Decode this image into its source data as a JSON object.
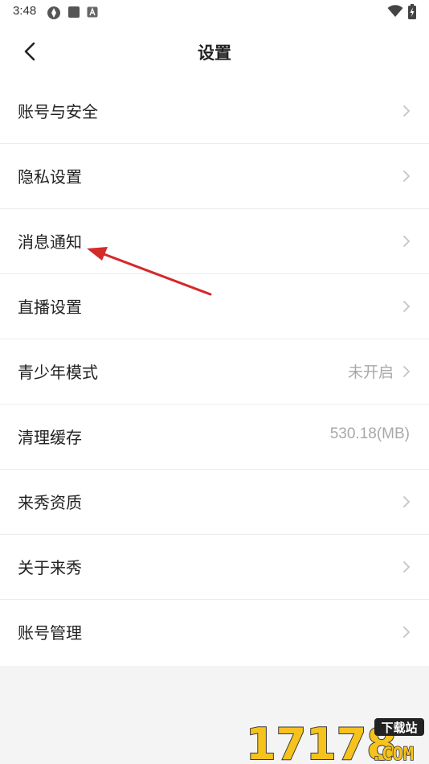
{
  "status": {
    "time": "3:48"
  },
  "header": {
    "title": "设置"
  },
  "rows": [
    {
      "label": "账号与安全",
      "value": "",
      "chevron": true
    },
    {
      "label": "隐私设置",
      "value": "",
      "chevron": true
    },
    {
      "label": "消息通知",
      "value": "",
      "chevron": true
    },
    {
      "label": "直播设置",
      "value": "",
      "chevron": true
    },
    {
      "label": "青少年模式",
      "value": "未开启",
      "chevron": true
    },
    {
      "label": "清理缓存",
      "value": "530.18(MB)",
      "chevron": false
    },
    {
      "label": "来秀资质",
      "value": "",
      "chevron": true
    },
    {
      "label": "关于来秀",
      "value": "",
      "chevron": true
    },
    {
      "label": "账号管理",
      "value": "",
      "chevron": true
    }
  ],
  "watermark": {
    "number": "17178",
    "tag": "下载站",
    "domain": ".COM"
  },
  "colors": {
    "annotation_arrow": "#d42a2a",
    "watermark_yellow": "#f6c21c"
  }
}
